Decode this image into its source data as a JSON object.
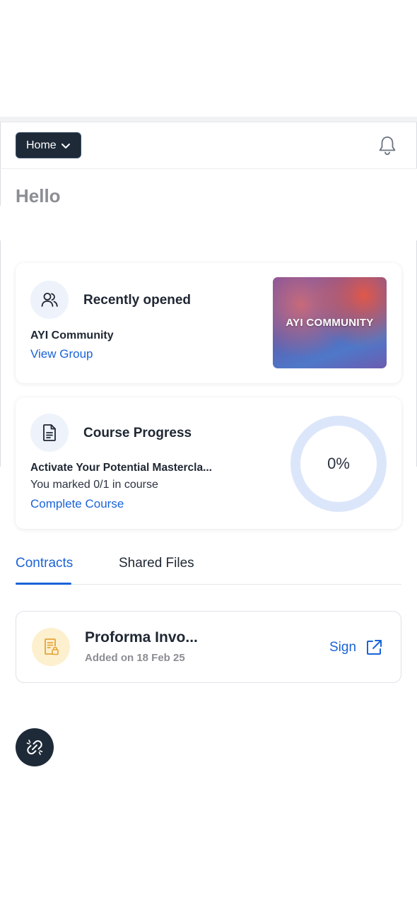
{
  "header": {
    "home_label": "Home"
  },
  "greeting": "Hello",
  "recent": {
    "title": "Recently opened",
    "name": "AYI Community",
    "link": "View Group",
    "thumbnail_text": "AYI COMMUNITY"
  },
  "course": {
    "title": "Course Progress",
    "name": "Activate Your Potential Mastercla...",
    "status": "You marked 0/1 in course",
    "link": "Complete Course",
    "progress_label": "0%",
    "progress_value": 0
  },
  "tabs": {
    "contracts": "Contracts",
    "shared_files": "Shared Files",
    "active": "contracts"
  },
  "contract": {
    "title": "Proforma Invo...",
    "date": "Added on 18 Feb 25",
    "action": "Sign"
  },
  "colors": {
    "accent": "#1a63d8",
    "dark": "#1e2a38",
    "ring": "#dce6fb",
    "doc_bg": "#fdf0cf",
    "doc_fg": "#e3a43a"
  },
  "icons": {
    "home_chevron": "chevron-down-icon",
    "bell": "bell-icon",
    "recent": "users-icon",
    "course": "document-icon",
    "contract": "contract-lock-icon",
    "sign": "external-link-icon",
    "fab": "link-broken-icon"
  }
}
